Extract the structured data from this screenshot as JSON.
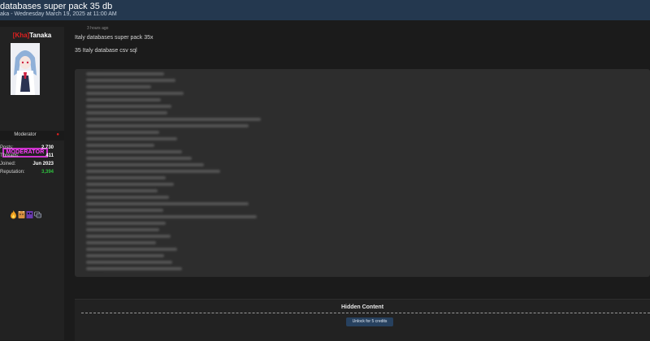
{
  "thread": {
    "title": "databases super pack 35 db",
    "meta": "aka - Wednesday March 19, 2025 at 11:00 AM"
  },
  "user": {
    "tag": "[Kha]",
    "name": "Tanaka",
    "role": "Moderator",
    "badge": "MODERATOR",
    "stats": [
      {
        "label": "Posts:",
        "value": "2,730"
      },
      {
        "label": "Threads:",
        "value": "411"
      },
      {
        "label": "Joined:",
        "value": "Jun 2023"
      },
      {
        "label": "Reputation:",
        "value": "3,394"
      }
    ],
    "award_icons": [
      "fire-icon",
      "cat-icon",
      "box-icon",
      "chat-icon"
    ]
  },
  "post": {
    "time": "3 hours ago",
    "line1": "Italy databases super pack 35x",
    "line2": "35 Italy database  csv sql"
  },
  "hidden": {
    "title": "Hidden Content",
    "button": "Unlock for 5 credits"
  },
  "colors": {
    "topbar": "#24384f",
    "accent_red": "#e02020",
    "badge_magenta": "#ff3bff",
    "rep_green": "#2fbf3f",
    "unlock_button": "#27415f"
  }
}
